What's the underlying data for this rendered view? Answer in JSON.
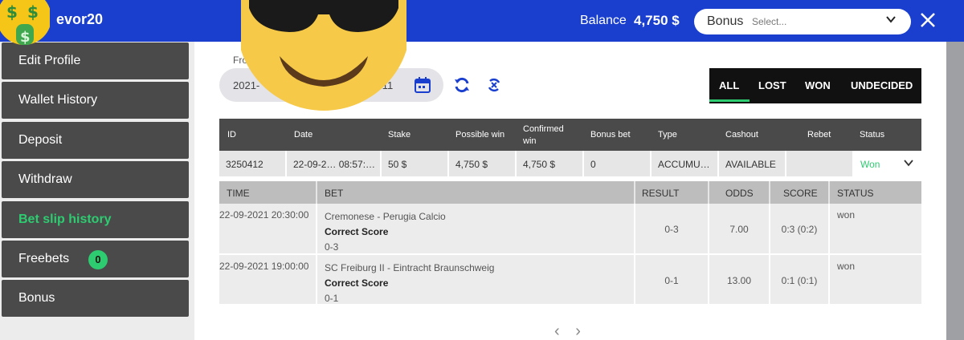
{
  "header": {
    "username": "evor20",
    "balance_label": "Balance",
    "balance_value": "4,750 $",
    "bonus_label": "Bonus",
    "bonus_placeholder": "Select...",
    "accent": "#1a3fcf"
  },
  "sidebar": {
    "items": [
      {
        "label": "Edit Profile"
      },
      {
        "label": "Wallet History"
      },
      {
        "label": "Deposit"
      },
      {
        "label": "Withdraw"
      },
      {
        "label": "Bet slip history"
      },
      {
        "label": "Freebets",
        "badge": "0"
      },
      {
        "label": "Bonus"
      }
    ],
    "active_color": "#2ecc71"
  },
  "filters": {
    "from_label": "Fro",
    "date_from": "2021-",
    "date_to": "09-11",
    "tabs": [
      "ALL",
      "LOST",
      "WON",
      "UNDECIDED"
    ]
  },
  "summary": {
    "headers": [
      "ID",
      "Date",
      "Stake",
      "Possible win",
      "Confirmed win",
      "Bonus bet",
      "Type",
      "Cashout",
      "Rebet",
      "Status"
    ],
    "row": {
      "id": "3250412",
      "date": "22-09-2… 08:57:…",
      "stake": "50 $",
      "possible_win": "4,750 $",
      "confirmed_win": "4,750 $",
      "bonus_bet": "0",
      "type": "ACCUMU…",
      "cashout": "AVAILABLE",
      "rebet": "",
      "status": "Won"
    }
  },
  "details": {
    "headers": [
      "TIME",
      "BET",
      "RESULT",
      "ODDS",
      "SCORE",
      "STATUS"
    ],
    "rows": [
      {
        "time": "22-09-2021 20:30:00",
        "event": "Cremonese - Perugia Calcio",
        "market": "Correct Score",
        "selection": "0-3",
        "result": "0-3",
        "odds": "7.00",
        "score": "0:3 (0:2)",
        "status": "won"
      },
      {
        "time": "22-09-2021 19:00:00",
        "event": "SC Freiburg II - Eintracht Braunschweig",
        "market": "Correct Score",
        "selection": "0-1",
        "result": "0-1",
        "odds": "13.00",
        "score": "0:1 (0:1)",
        "status": "won"
      }
    ]
  },
  "pager": {
    "prev": "‹",
    "next": "›"
  },
  "icons": [
    "money-mouth-emoji",
    "sunglasses-emoji",
    "calendar-icon",
    "refresh-icon",
    "reset-icon",
    "close-icon",
    "chevron-down-icon"
  ]
}
